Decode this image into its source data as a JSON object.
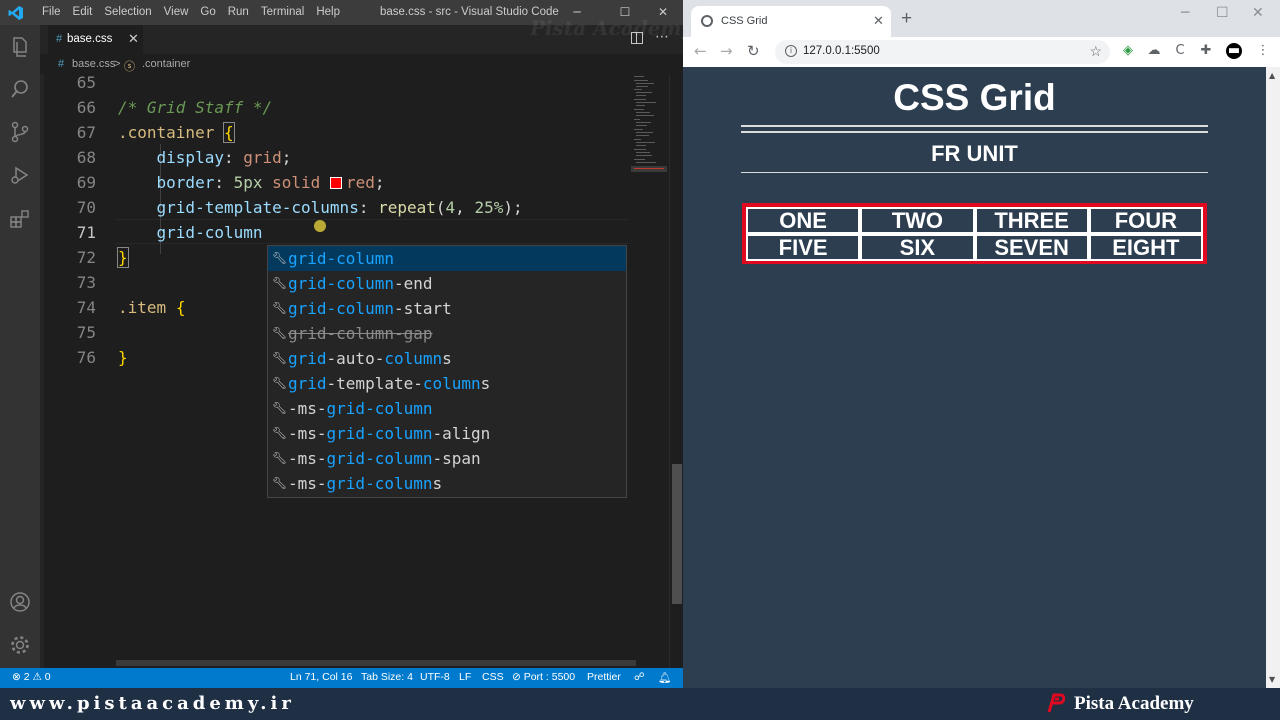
{
  "vscode": {
    "menu": [
      "File",
      "Edit",
      "Selection",
      "View",
      "Go",
      "Run",
      "Terminal",
      "Help"
    ],
    "window_title": "base.css - src - Visual Studio Code",
    "tab": {
      "name": "base.css",
      "icon": "#"
    },
    "breadcrumb": {
      "file": "base.css",
      "separator": ">",
      "symbol": ".container"
    },
    "lines": [
      {
        "n": "65"
      },
      {
        "n": "66"
      },
      {
        "n": "67"
      },
      {
        "n": "68"
      },
      {
        "n": "69"
      },
      {
        "n": "70"
      },
      {
        "n": "71"
      },
      {
        "n": "72"
      },
      {
        "n": "73"
      },
      {
        "n": "74"
      },
      {
        "n": "75"
      },
      {
        "n": "76"
      }
    ],
    "code": {
      "comment": "/* Grid Staff */",
      "selector_container": ".container",
      "brace_open": "{",
      "brace_close": "}",
      "prop_display": "display",
      "val_display": "grid",
      "prop_border": "border",
      "val_border_a": "5px",
      "val_border_b": "solid",
      "val_border_c": "red",
      "prop_gtc": "grid-template-columns",
      "fn_repeat": "repeat",
      "num_4": "4",
      "num_25": "25%",
      "typing": "grid-column",
      "selector_item": ".item",
      "color_swatch": "#ff0000"
    },
    "suggestions": [
      {
        "pre": "",
        "match": "grid-column",
        "post": "",
        "selected": true,
        "deprecated": false
      },
      {
        "pre": "",
        "match": "grid-column",
        "post": "-end",
        "selected": false,
        "deprecated": false
      },
      {
        "pre": "",
        "match": "grid-column",
        "post": "-start",
        "selected": false,
        "deprecated": false
      },
      {
        "pre": "",
        "match": "grid-column",
        "post": "-gap",
        "selected": false,
        "deprecated": true
      },
      {
        "pre": "",
        "match": "grid",
        "post": "-auto-",
        "match2": "column",
        "post2": "s",
        "selected": false,
        "deprecated": false
      },
      {
        "pre": "",
        "match": "grid",
        "post": "-template-",
        "match2": "column",
        "post2": "s",
        "selected": false,
        "deprecated": false
      },
      {
        "pre": "-ms-",
        "match": "grid-column",
        "post": "",
        "selected": false,
        "deprecated": false
      },
      {
        "pre": "-ms-",
        "match": "grid-column",
        "post": "-align",
        "selected": false,
        "deprecated": false
      },
      {
        "pre": "-ms-",
        "match": "grid-column",
        "post": "-span",
        "selected": false,
        "deprecated": false
      },
      {
        "pre": "-ms-",
        "match": "grid-column",
        "post": "s",
        "selected": false,
        "deprecated": false
      }
    ],
    "status": {
      "problems": "⊗ 2 ⚠ 0",
      "position": "Ln 71, Col 16",
      "tab_size": "Tab Size: 4",
      "encoding": "UTF-8",
      "eol": "LF",
      "language": "CSS",
      "port": "⊘ Port : 5500",
      "formatter": "Prettier"
    },
    "accent": "#007acc"
  },
  "browser": {
    "tab_title": "CSS Grid",
    "url": "127.0.0.1:5500",
    "page_title": "CSS Grid",
    "subtitle": "FR UNIT",
    "grid_items": [
      "ONE",
      "TWO",
      "THREE",
      "FOUR",
      "FIVE",
      "SIX",
      "SEVEN",
      "EIGHT"
    ],
    "page_bg": "#2c3e50",
    "grid_border": "#e0091f"
  },
  "footer": {
    "url": "www.pistaacademy.ir",
    "brand": "Pista Academy",
    "watermark": "Pista Academy"
  }
}
